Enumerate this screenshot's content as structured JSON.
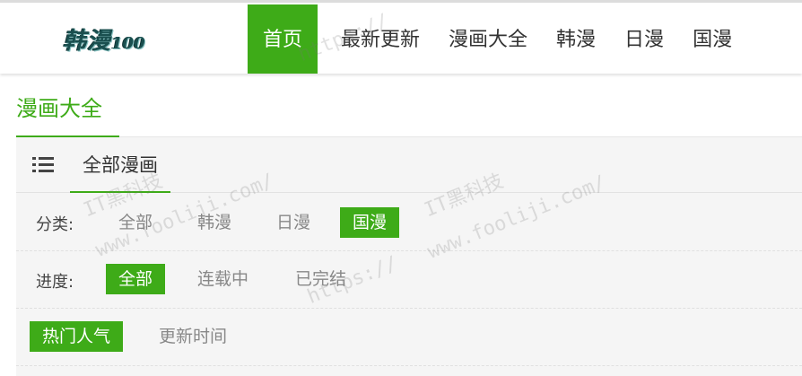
{
  "logo": {
    "text": "韩漫",
    "num": "100"
  },
  "nav": [
    {
      "label": "首页",
      "active": true
    },
    {
      "label": "最新更新"
    },
    {
      "label": "漫画大全"
    },
    {
      "label": "韩漫"
    },
    {
      "label": "日漫"
    },
    {
      "label": "国漫"
    }
  ],
  "section": {
    "title": "漫画大全"
  },
  "tabs": {
    "all_label": "全部漫画",
    "icon": "list-icon"
  },
  "filters": {
    "category": {
      "label": "分类:",
      "options": [
        "全部",
        "韩漫",
        "日漫",
        "国漫"
      ],
      "selected": "国漫"
    },
    "progress": {
      "label": "进度:",
      "options": [
        "全部",
        "连载中",
        "已完结"
      ],
      "selected": "全部"
    },
    "sort": {
      "options": [
        "热门人气",
        "更新时间"
      ],
      "selected": "热门人气"
    }
  },
  "watermark": {
    "line1": "IT黑科技",
    "line2": "www.fooliji.com/",
    "line3": "https://"
  },
  "colors": {
    "accent": "#3eab18",
    "panel_bg": "#f5f5f5"
  }
}
